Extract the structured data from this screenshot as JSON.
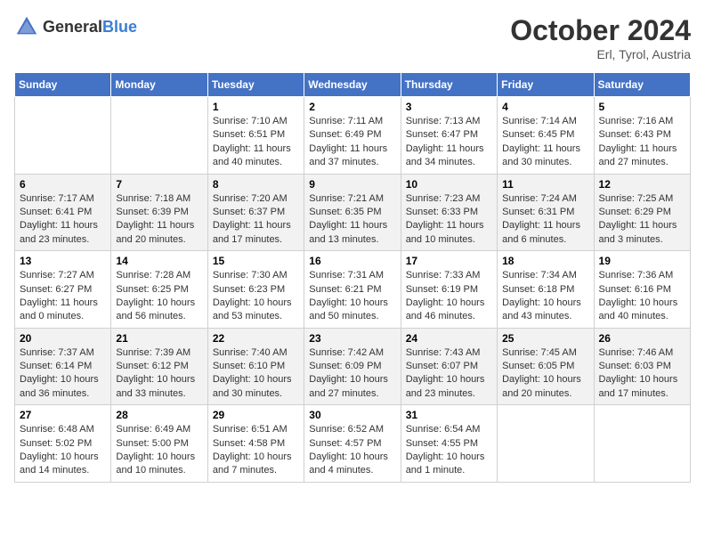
{
  "header": {
    "logo_general": "General",
    "logo_blue": "Blue",
    "month": "October 2024",
    "location": "Erl, Tyrol, Austria"
  },
  "days_of_week": [
    "Sunday",
    "Monday",
    "Tuesday",
    "Wednesday",
    "Thursday",
    "Friday",
    "Saturday"
  ],
  "weeks": [
    [
      {
        "day": "",
        "info": ""
      },
      {
        "day": "",
        "info": ""
      },
      {
        "day": "1",
        "info": "Sunrise: 7:10 AM\nSunset: 6:51 PM\nDaylight: 11 hours and 40 minutes."
      },
      {
        "day": "2",
        "info": "Sunrise: 7:11 AM\nSunset: 6:49 PM\nDaylight: 11 hours and 37 minutes."
      },
      {
        "day": "3",
        "info": "Sunrise: 7:13 AM\nSunset: 6:47 PM\nDaylight: 11 hours and 34 minutes."
      },
      {
        "day": "4",
        "info": "Sunrise: 7:14 AM\nSunset: 6:45 PM\nDaylight: 11 hours and 30 minutes."
      },
      {
        "day": "5",
        "info": "Sunrise: 7:16 AM\nSunset: 6:43 PM\nDaylight: 11 hours and 27 minutes."
      }
    ],
    [
      {
        "day": "6",
        "info": "Sunrise: 7:17 AM\nSunset: 6:41 PM\nDaylight: 11 hours and 23 minutes."
      },
      {
        "day": "7",
        "info": "Sunrise: 7:18 AM\nSunset: 6:39 PM\nDaylight: 11 hours and 20 minutes."
      },
      {
        "day": "8",
        "info": "Sunrise: 7:20 AM\nSunset: 6:37 PM\nDaylight: 11 hours and 17 minutes."
      },
      {
        "day": "9",
        "info": "Sunrise: 7:21 AM\nSunset: 6:35 PM\nDaylight: 11 hours and 13 minutes."
      },
      {
        "day": "10",
        "info": "Sunrise: 7:23 AM\nSunset: 6:33 PM\nDaylight: 11 hours and 10 minutes."
      },
      {
        "day": "11",
        "info": "Sunrise: 7:24 AM\nSunset: 6:31 PM\nDaylight: 11 hours and 6 minutes."
      },
      {
        "day": "12",
        "info": "Sunrise: 7:25 AM\nSunset: 6:29 PM\nDaylight: 11 hours and 3 minutes."
      }
    ],
    [
      {
        "day": "13",
        "info": "Sunrise: 7:27 AM\nSunset: 6:27 PM\nDaylight: 11 hours and 0 minutes."
      },
      {
        "day": "14",
        "info": "Sunrise: 7:28 AM\nSunset: 6:25 PM\nDaylight: 10 hours and 56 minutes."
      },
      {
        "day": "15",
        "info": "Sunrise: 7:30 AM\nSunset: 6:23 PM\nDaylight: 10 hours and 53 minutes."
      },
      {
        "day": "16",
        "info": "Sunrise: 7:31 AM\nSunset: 6:21 PM\nDaylight: 10 hours and 50 minutes."
      },
      {
        "day": "17",
        "info": "Sunrise: 7:33 AM\nSunset: 6:19 PM\nDaylight: 10 hours and 46 minutes."
      },
      {
        "day": "18",
        "info": "Sunrise: 7:34 AM\nSunset: 6:18 PM\nDaylight: 10 hours and 43 minutes."
      },
      {
        "day": "19",
        "info": "Sunrise: 7:36 AM\nSunset: 6:16 PM\nDaylight: 10 hours and 40 minutes."
      }
    ],
    [
      {
        "day": "20",
        "info": "Sunrise: 7:37 AM\nSunset: 6:14 PM\nDaylight: 10 hours and 36 minutes."
      },
      {
        "day": "21",
        "info": "Sunrise: 7:39 AM\nSunset: 6:12 PM\nDaylight: 10 hours and 33 minutes."
      },
      {
        "day": "22",
        "info": "Sunrise: 7:40 AM\nSunset: 6:10 PM\nDaylight: 10 hours and 30 minutes."
      },
      {
        "day": "23",
        "info": "Sunrise: 7:42 AM\nSunset: 6:09 PM\nDaylight: 10 hours and 27 minutes."
      },
      {
        "day": "24",
        "info": "Sunrise: 7:43 AM\nSunset: 6:07 PM\nDaylight: 10 hours and 23 minutes."
      },
      {
        "day": "25",
        "info": "Sunrise: 7:45 AM\nSunset: 6:05 PM\nDaylight: 10 hours and 20 minutes."
      },
      {
        "day": "26",
        "info": "Sunrise: 7:46 AM\nSunset: 6:03 PM\nDaylight: 10 hours and 17 minutes."
      }
    ],
    [
      {
        "day": "27",
        "info": "Sunrise: 6:48 AM\nSunset: 5:02 PM\nDaylight: 10 hours and 14 minutes."
      },
      {
        "day": "28",
        "info": "Sunrise: 6:49 AM\nSunset: 5:00 PM\nDaylight: 10 hours and 10 minutes."
      },
      {
        "day": "29",
        "info": "Sunrise: 6:51 AM\nSunset: 4:58 PM\nDaylight: 10 hours and 7 minutes."
      },
      {
        "day": "30",
        "info": "Sunrise: 6:52 AM\nSunset: 4:57 PM\nDaylight: 10 hours and 4 minutes."
      },
      {
        "day": "31",
        "info": "Sunrise: 6:54 AM\nSunset: 4:55 PM\nDaylight: 10 hours and 1 minute."
      },
      {
        "day": "",
        "info": ""
      },
      {
        "day": "",
        "info": ""
      }
    ]
  ]
}
